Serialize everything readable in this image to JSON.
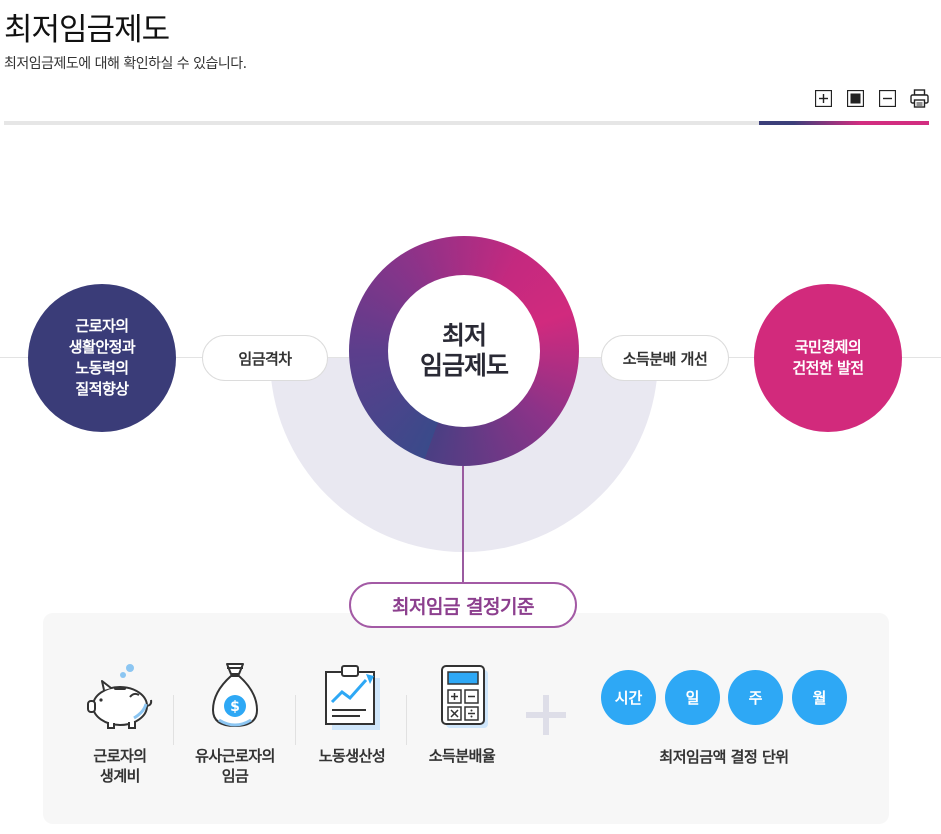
{
  "header": {
    "title": "최저임금제도",
    "description": "최저임금제도에 대해 확인하실 수 있습니다."
  },
  "toolbar": {
    "zoom_in_icon": "plus-square-icon",
    "reset_icon": "filled-square-icon",
    "zoom_out_icon": "minus-square-icon",
    "print_icon": "printer-icon"
  },
  "diagram": {
    "left_circle": "근로자의\n생활안정과\n노동력의\n질적향상",
    "left_pill": "임금격차",
    "center": "최저\n임금제도",
    "right_pill": "소득분배 개선",
    "right_circle": "국민경제의\n건전한 발전",
    "colors": {
      "navy": "#3a3c78",
      "magenta": "#d22a7c",
      "purple": "#9a5ba0",
      "blue": "#2ea8f5"
    }
  },
  "criteria": {
    "title": "최저임금 결정기준",
    "items": [
      {
        "label": "근로자의\n생계비",
        "icon": "piggy-bank-icon"
      },
      {
        "label": "유사근로자의\n임금",
        "icon": "money-bag-icon"
      },
      {
        "label": "노동생산성",
        "icon": "growth-chart-icon"
      },
      {
        "label": "소득분배율",
        "icon": "calculator-icon"
      }
    ],
    "units": [
      "시간",
      "일",
      "주",
      "월"
    ],
    "units_caption": "최저임금액 결정 단위"
  }
}
